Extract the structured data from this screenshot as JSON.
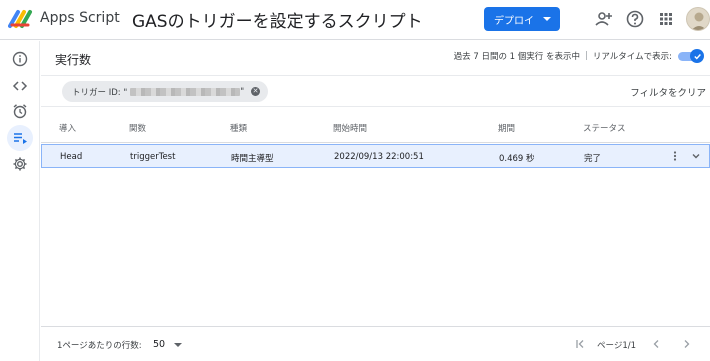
{
  "header": {
    "app_name": "Apps Script",
    "project_title": "GASのトリガーを設定するスクリプト",
    "deploy_label": "デプロイ"
  },
  "icons": {
    "rail": [
      "info-icon",
      "code-icon",
      "alarm-icon",
      "executions-icon",
      "settings-icon"
    ],
    "header": [
      "person-add-icon",
      "help-icon",
      "apps-grid-icon"
    ],
    "accent": "#1a73e8"
  },
  "executions": {
    "title": "実行数",
    "realtime_desc": "過去 7 日間の 1 個実行 を表示中",
    "realtime_label": "リアルタイムで表示:",
    "realtime_on": true
  },
  "filter": {
    "chip_label": "トリガー ID: \"",
    "chip_tail": "\"",
    "clear_label": "フィルタをクリア"
  },
  "table": {
    "columns": [
      "導入",
      "関数",
      "種類",
      "開始時間",
      "期間",
      "ステータス"
    ],
    "rows": [
      [
        "Head",
        "triggerTest",
        "時間主導型",
        "2022/09/13 22:00:51",
        "0.469 秒",
        "完了"
      ]
    ]
  },
  "footer": {
    "rows_per_page_label": "1ページあたりの行数:",
    "rows_per_page_value": "50",
    "page_indicator": "ページ1/1"
  }
}
